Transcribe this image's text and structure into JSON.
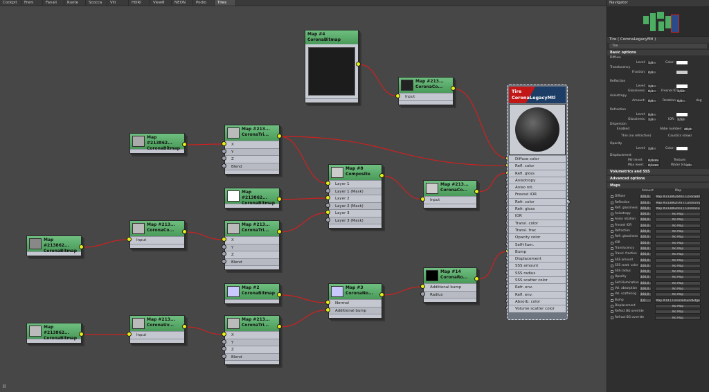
{
  "tabs": [
    "Cockpit",
    "Freni",
    "Fanali",
    "Ruote",
    "Scocca",
    "Vili",
    "HDRI",
    "View8",
    "NEON",
    "Podio",
    "Tires"
  ],
  "active_tab": "Tires",
  "nodes": {
    "map4": {
      "title": "Map #4",
      "type": "CoronaBitmap"
    },
    "cc_top": {
      "title": "Map #213...",
      "type": "CoronaCo...",
      "rows": [
        "Input"
      ]
    },
    "bmp_a": {
      "title": "Map #213862...",
      "type": "CoronaBitmap"
    },
    "tri_a": {
      "title": "Map #213...",
      "type": "CoronaTri...",
      "rows": [
        "X",
        "Y",
        "Z",
        "Blend"
      ]
    },
    "bmp_b": {
      "title": "Map #213862...",
      "type": "CoronaBitmap"
    },
    "composite": {
      "title": "Map #8",
      "type": "Composite",
      "rows": [
        "Layer 1",
        "Layer 1 (Mask)",
        "Layer 2",
        "Layer 2 (Mask)",
        "Layer 3",
        "Layer 3 (Mask)"
      ]
    },
    "cc_mid": {
      "title": "Map #213...",
      "type": "CoronaCo...",
      "rows": [
        "Input"
      ]
    },
    "bmp_c": {
      "title": "Map #213862...",
      "type": "CoronaBitmap"
    },
    "cc_left": {
      "title": "Map #213...",
      "type": "CoronaCo...",
      "rows": [
        "Input"
      ]
    },
    "tri_b": {
      "title": "Map #213...",
      "type": "CoronaTri...",
      "rows": [
        "X",
        "Y",
        "Z",
        "Blend"
      ]
    },
    "map2": {
      "title": "Map #2",
      "type": "CoronaBitmap"
    },
    "map3": {
      "title": "Map #3",
      "type": "CoronaNo...",
      "rows": [
        "Normal",
        "Additional bump"
      ]
    },
    "map14": {
      "title": "Map #14",
      "type": "CoronaRo...",
      "rows": [
        "Additional bump",
        "Radius"
      ]
    },
    "bmp_d": {
      "title": "Map #213862...",
      "type": "CoronaBitmap"
    },
    "uv": {
      "title": "Map #213...",
      "type": "CoronaUv...",
      "rows": [
        "Input"
      ]
    },
    "tri_c": {
      "title": "Map #213...",
      "type": "CoronaTri...",
      "rows": [
        "X",
        "Y",
        "Z",
        "Blend"
      ]
    }
  },
  "material": {
    "title": "Tire",
    "type": "CoronaLegacyMtl",
    "slots": [
      "Diffuse color",
      "Refl. color",
      "Refl. gloss",
      "Anisotropy",
      "Aniso rot.",
      "Fresnel IOR",
      "Refr. color",
      "Refr. gloss",
      "IOR",
      "Transl. color",
      "Transl. frac",
      "Opacity color",
      "Self-illum.",
      "Bump",
      "Displacement",
      "SSS amount",
      "SSS radius",
      "SSS scatter color",
      "Refr. env.",
      "Refl. env.",
      "Absorb. color",
      "Volume scatter color"
    ]
  },
  "panel": {
    "navigator": "Navigator",
    "mat_title": "Tire ( CoronaLegacyMtl )",
    "mat_name": "Tire",
    "basic": "Basic options",
    "diffuse": "Diffuse",
    "level": "Level:",
    "color": "Color:",
    "translucency": "Translucency",
    "fraction": "Fraction:",
    "reflection": "Reflection",
    "glossiness": "Glossiness:",
    "fresnel": "Fresnel IOR:",
    "anisotropy": "Anisotropy",
    "amount": "Amount:",
    "rotation": "Rotation:",
    "deg": "deg",
    "refraction": "Refraction",
    "ior": "IOR:",
    "dispersion": "Dispersion",
    "enabled": "Enabled",
    "abbe": "Abbe number:",
    "thin": "Thin (no refraction)",
    "caustics": "Caustics (slow)",
    "opacity": "Opacity",
    "displacement": "Displacement",
    "min_level": "Min level:",
    "max_level": "Max level:",
    "texture": "Texture:",
    "water": "Water lvl:",
    "vals": {
      "diff_level": "1,0",
      "fraction": "0,0",
      "refl_level": "1,0",
      "gloss": "0,3",
      "fresnel": "1,52",
      "aniso_amt": "0,0",
      "rot": "0,0",
      "refr_level": "0,0",
      "refr_gloss": "1,0",
      "ior": "1,52",
      "abbe": "40,0",
      "op_level": "1,0",
      "min": "0,0cm",
      "max": "0,1cm",
      "water": "0,5"
    },
    "vol": "Volumetrics and SSS",
    "adv": "Advanced options",
    "maps": "Maps",
    "maps_hdr": {
      "amount": "Amount",
      "map": "Map"
    },
    "map_rows": [
      {
        "name": "Diffuse",
        "amt": "100,0",
        "map": "Map #213862649 ( CoronaBit"
      },
      {
        "name": "Reflection",
        "amt": "100,0",
        "map": "Map #213862ll76 ( CoronaTrip"
      },
      {
        "name": "Refl. glossiness",
        "amt": "100,0",
        "map": "Map #213862nll3 ( CoronaCol"
      },
      {
        "name": "Anisotropy",
        "amt": "100,0",
        "map": "No Map"
      },
      {
        "name": "Aniso rotation",
        "amt": "100,0",
        "map": "No Map"
      },
      {
        "name": "Fresnel IOR",
        "amt": "100,0",
        "map": "No Map"
      },
      {
        "name": "Refraction",
        "amt": "100,0",
        "map": "No Map"
      },
      {
        "name": "Refr. glossiness",
        "amt": "100,0",
        "map": "No Map"
      },
      {
        "name": "IOR",
        "amt": "100,0",
        "map": "No Map"
      },
      {
        "name": "Translucency",
        "amt": "100,0",
        "map": "No Map"
      },
      {
        "name": "Transl. fraction",
        "amt": "100,0",
        "map": "No Map"
      },
      {
        "name": "SSS amount",
        "amt": "100,0",
        "map": "No Map"
      },
      {
        "name": "SSS scatt. color",
        "amt": "100,0",
        "map": "No Map"
      },
      {
        "name": "SSS radius",
        "amt": "100,0",
        "map": "No Map"
      },
      {
        "name": "Opacity",
        "amt": "100,0",
        "map": "No Map"
      },
      {
        "name": "Self-illumination",
        "amt": "100,0",
        "map": "No Map"
      },
      {
        "name": "Vol. absorption",
        "amt": "100,0",
        "map": "No Map"
      },
      {
        "name": "Vol. scattering",
        "amt": "100,0",
        "map": "No Map"
      },
      {
        "name": "Bump",
        "amt": "1,0",
        "map": "Map #14 ( CoronaRoundEdges )"
      },
      {
        "name": "Displacement",
        "amt": "",
        "map": "No Map"
      },
      {
        "name": "Reflect BG override",
        "amt": "",
        "map": "No Map"
      },
      {
        "name": "Refract BG override",
        "amt": "",
        "map": "No Map"
      }
    ]
  },
  "pause": "II"
}
